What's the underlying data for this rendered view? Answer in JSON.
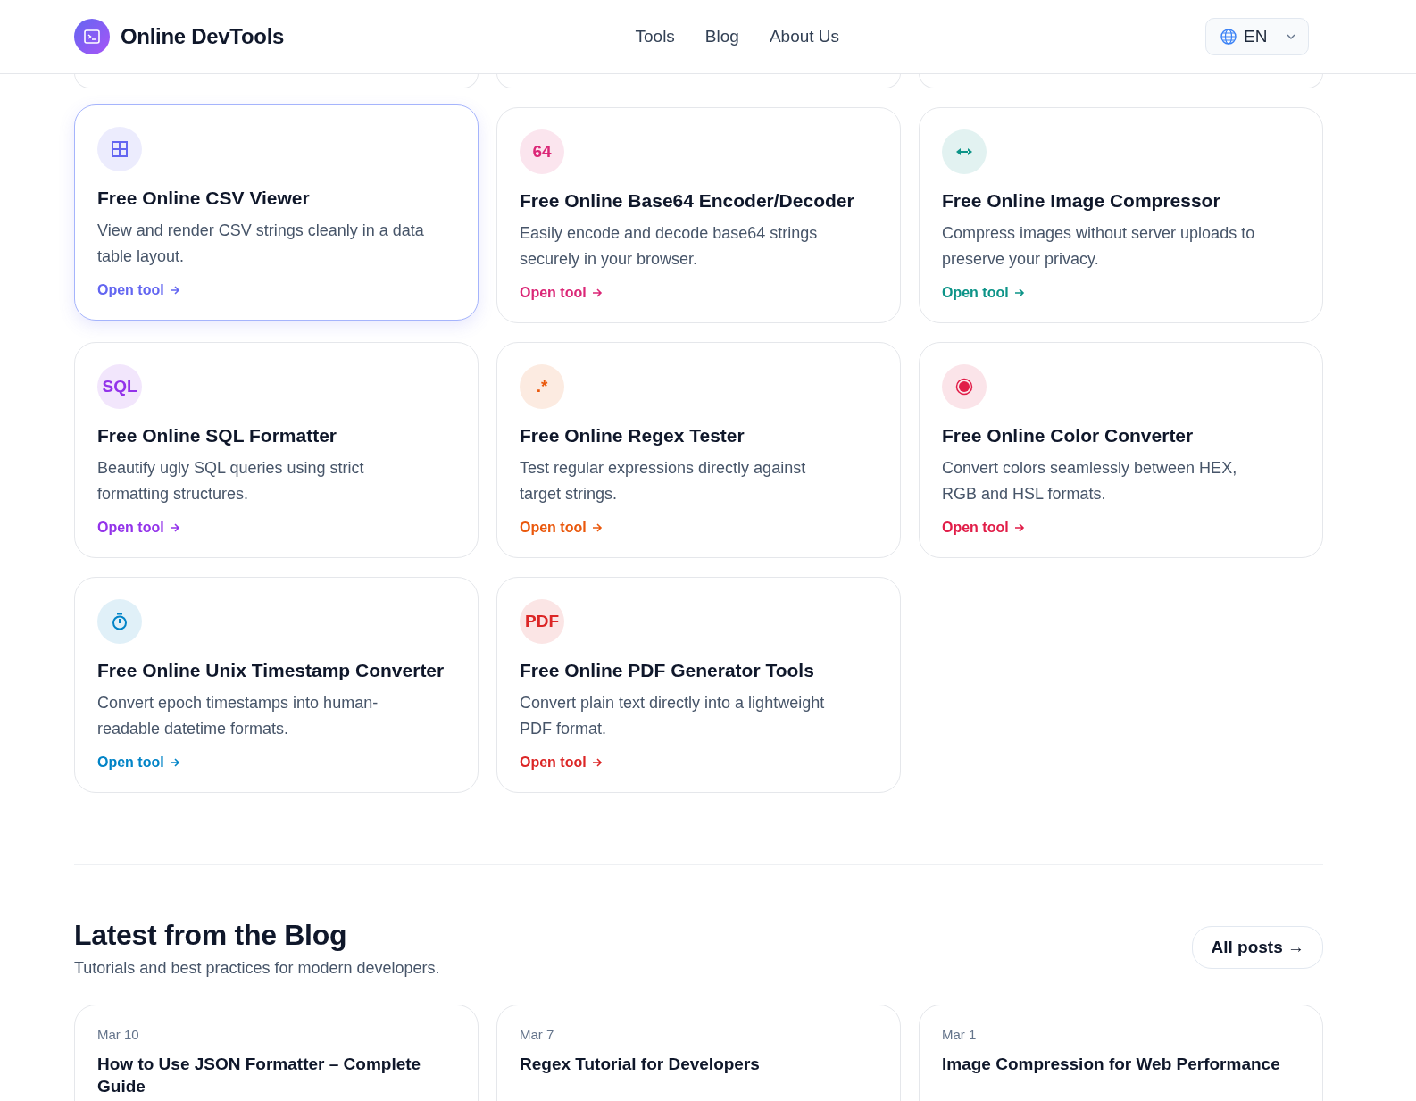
{
  "header": {
    "brand": "Online DevTools",
    "nav": [
      {
        "label": "Tools"
      },
      {
        "label": "Blog"
      },
      {
        "label": "About Us"
      }
    ],
    "language": "EN"
  },
  "tools": [
    {
      "icon": {
        "kind": "grid"
      },
      "title": "Free Online CSV Viewer",
      "description": "View and render CSV strings cleanly in a data table layout.",
      "link": "Open tool",
      "color": "#6366f1",
      "selected": true
    },
    {
      "icon": {
        "kind": "text",
        "text": "64"
      },
      "title": "Free Online Base64 Encoder/Decoder",
      "description": "Easily encode and decode base64 strings securely in your browser.",
      "link": "Open tool",
      "color": "#db2777",
      "selected": false
    },
    {
      "icon": {
        "kind": "arrows"
      },
      "title": "Free Online Image Compressor",
      "description": "Compress images without server uploads to preserve your privacy.",
      "link": "Open tool",
      "color": "#0d9488",
      "selected": false
    },
    {
      "icon": {
        "kind": "text",
        "text": "SQL"
      },
      "title": "Free Online SQL Formatter",
      "description": "Beautify ugly SQL queries using strict formatting structures.",
      "link": "Open tool",
      "color": "#9333ea",
      "selected": false
    },
    {
      "icon": {
        "kind": "text",
        "text": ".*"
      },
      "title": "Free Online Regex Tester",
      "description": "Test regular expressions directly against target strings.",
      "link": "Open tool",
      "color": "#ea580c",
      "selected": false
    },
    {
      "icon": {
        "kind": "record"
      },
      "title": "Free Online Color Converter",
      "description": "Convert colors seamlessly between HEX, RGB and HSL formats.",
      "link": "Open tool",
      "color": "#e11d48",
      "selected": false
    },
    {
      "icon": {
        "kind": "timer"
      },
      "title": "Free Online Unix Timestamp Converter",
      "description": "Convert epoch timestamps into human-readable datetime formats.",
      "link": "Open tool",
      "color": "#0284c7",
      "selected": false
    },
    {
      "icon": {
        "kind": "text",
        "text": "PDF"
      },
      "title": "Free Online PDF Generator Tools",
      "description": "Convert plain text directly into a lightweight PDF format.",
      "link": "Open tool",
      "color": "#dc2626",
      "selected": false
    }
  ],
  "blog": {
    "title": "Latest from the Blog",
    "subtitle": "Tutorials and best practices for modern developers.",
    "all_posts": "All posts →",
    "posts": [
      {
        "date": "Mar 10",
        "title": "How to Use JSON Formatter – Complete Guide"
      },
      {
        "date": "Mar 7",
        "title": "Regex Tutorial for Developers"
      },
      {
        "date": "Mar 1",
        "title": "Image Compression for Web Performance"
      }
    ]
  }
}
